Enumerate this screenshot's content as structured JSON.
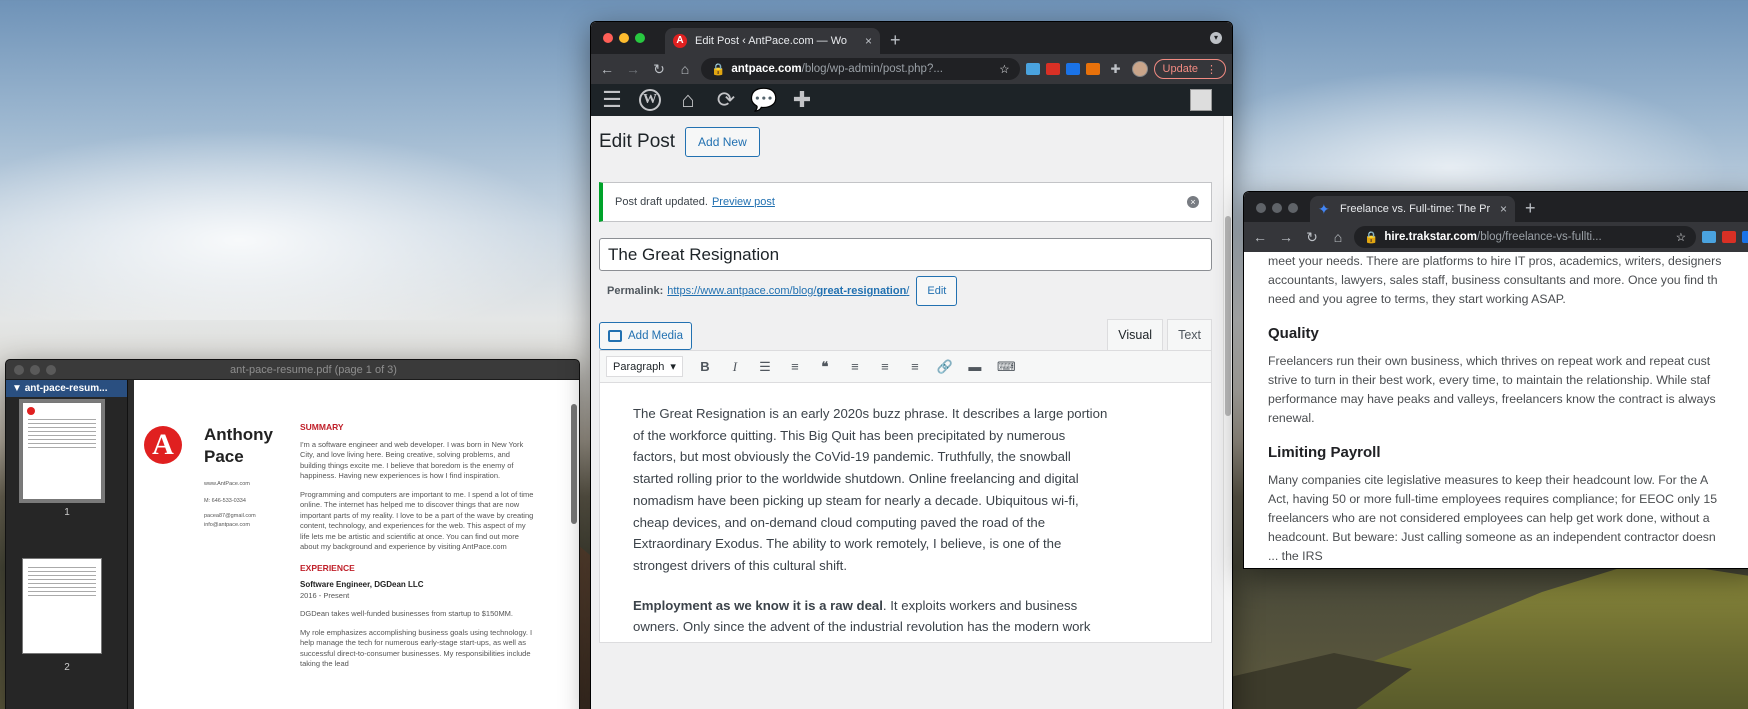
{
  "preview": {
    "title": "ant-pace-resume.pdf (page 1 of 3)",
    "sidebar_header": "ant-pace-resum...",
    "thumb_nums": [
      "1",
      "2"
    ],
    "resume": {
      "logo": "A",
      "name": "Anthony Pace",
      "website": "www.AntPace.com",
      "phone": "M: 646-533-0334",
      "email1": "pacea87@gmail.com",
      "email2": "info@antpace.com",
      "summary_heading": "SUMMARY",
      "summary_p1": "I'm a software engineer and web developer. I was born in New York City, and love living here. Being creative, solving problems, and building things excite me. I believe that boredom is the enemy of happiness. Having new experiences is how I find inspiration.",
      "summary_p2": "Programming and computers are important to me. I spend a lot of time online. The internet has helped me to discover things that are now important parts of my reality. I love to be a part of the wave by creating content, technology, and experiences for the web. This aspect of my life lets me be artistic and scientific at once. You can find out more about my background and experience by visiting AntPace.com",
      "experience_heading": "EXPERIENCE",
      "job_title": "Software Engineer, DGDean LLC",
      "job_dates": "2016 - Present",
      "job_p1": "DGDean takes well-funded businesses from startup to $150MM.",
      "job_p2": "My role emphasizes accomplishing business goals using technology. I help manage the tech for numerous early-stage start-ups, as well as successful direct-to-consumer businesses. My responsibilities include taking the lead"
    }
  },
  "wp": {
    "tab_title": "Edit Post ‹ AntPace.com — Wo",
    "tab_close": "×",
    "new_tab": "+",
    "url_host": "antpace.com",
    "url_path": "/blog/wp-admin/post.php?...",
    "update_label": "Update",
    "page_title": "Edit Post",
    "add_new": "Add New",
    "notice_text": "Post draft updated.",
    "notice_link": "Preview post",
    "post_title": "The Great Resignation",
    "permalink_label": "Permalink:",
    "permalink_base": "https://www.antpace.com/blog/",
    "permalink_slug": "great-resignation",
    "permalink_end": "/",
    "edit_label": "Edit",
    "add_media": "Add Media",
    "tab_visual": "Visual",
    "tab_text": "Text",
    "format_select": "Paragraph",
    "body_p1": "The Great Resignation is an early 2020s buzz phrase. It describes a large portion of the workforce quitting. This Big Quit has been precipitated by numerous factors, but most obviously the CoVid-19 pandemic. Truthfully, the snowball started rolling prior to the worldwide shutdown. Online freelancing and digital nomadism have been picking up steam for nearly a decade. Ubiquitous wi-fi, cheap devices, and on-demand cloud computing paved the road of the Extraordinary Exodus. The ability to work remotely, I believe, is one of the strongest drivers of this cultural shift.",
    "body_p2_bold": "Employment as we know it is a raw deal",
    "body_p2_rest": ". It exploits workers and business owners. Only since the advent of the industrial revolution has the modern work schedule and environment has taken this shape."
  },
  "trak": {
    "tab_title": "Freelance vs. Full-time: The Pr",
    "tab_close": "×",
    "new_tab": "+",
    "url_host": "hire.trakstar.com",
    "url_path": "/blog/freelance-vs-fullti...",
    "line_a1": "meet your needs. There are platforms to hire IT pros, academics, writers, designers",
    "line_a2": "accountants, lawyers, sales staff, business consultants and more. Once you find th",
    "line_a3": "need and you agree to terms, they start working ASAP.",
    "h_quality": "Quality",
    "line_b1": "Freelancers run their own business, which thrives on repeat work and repeat cust",
    "line_b2": "strive to turn in their best work, every time, to maintain the relationship. While staf",
    "line_b3": "performance may have peaks and valleys, freelancers know the contract is always",
    "line_b4": "renewal.",
    "h_payroll": "Limiting Payroll",
    "line_c1": "Many companies cite legislative measures to keep their headcount low. For the A",
    "line_c2": "Act, having 50 or more full-time employees requires compliance; for EEOC only 15",
    "line_c3": "freelancers who are not considered employees can help get work done, without a",
    "line_c4": "headcount. But beware: Just calling someone as an independent contractor doesn",
    "line_c5": "... the IRS"
  },
  "colors": {
    "wp_blue": "#2271b1",
    "notice_green": "#00a32a",
    "resume_red": "#c0202a"
  }
}
